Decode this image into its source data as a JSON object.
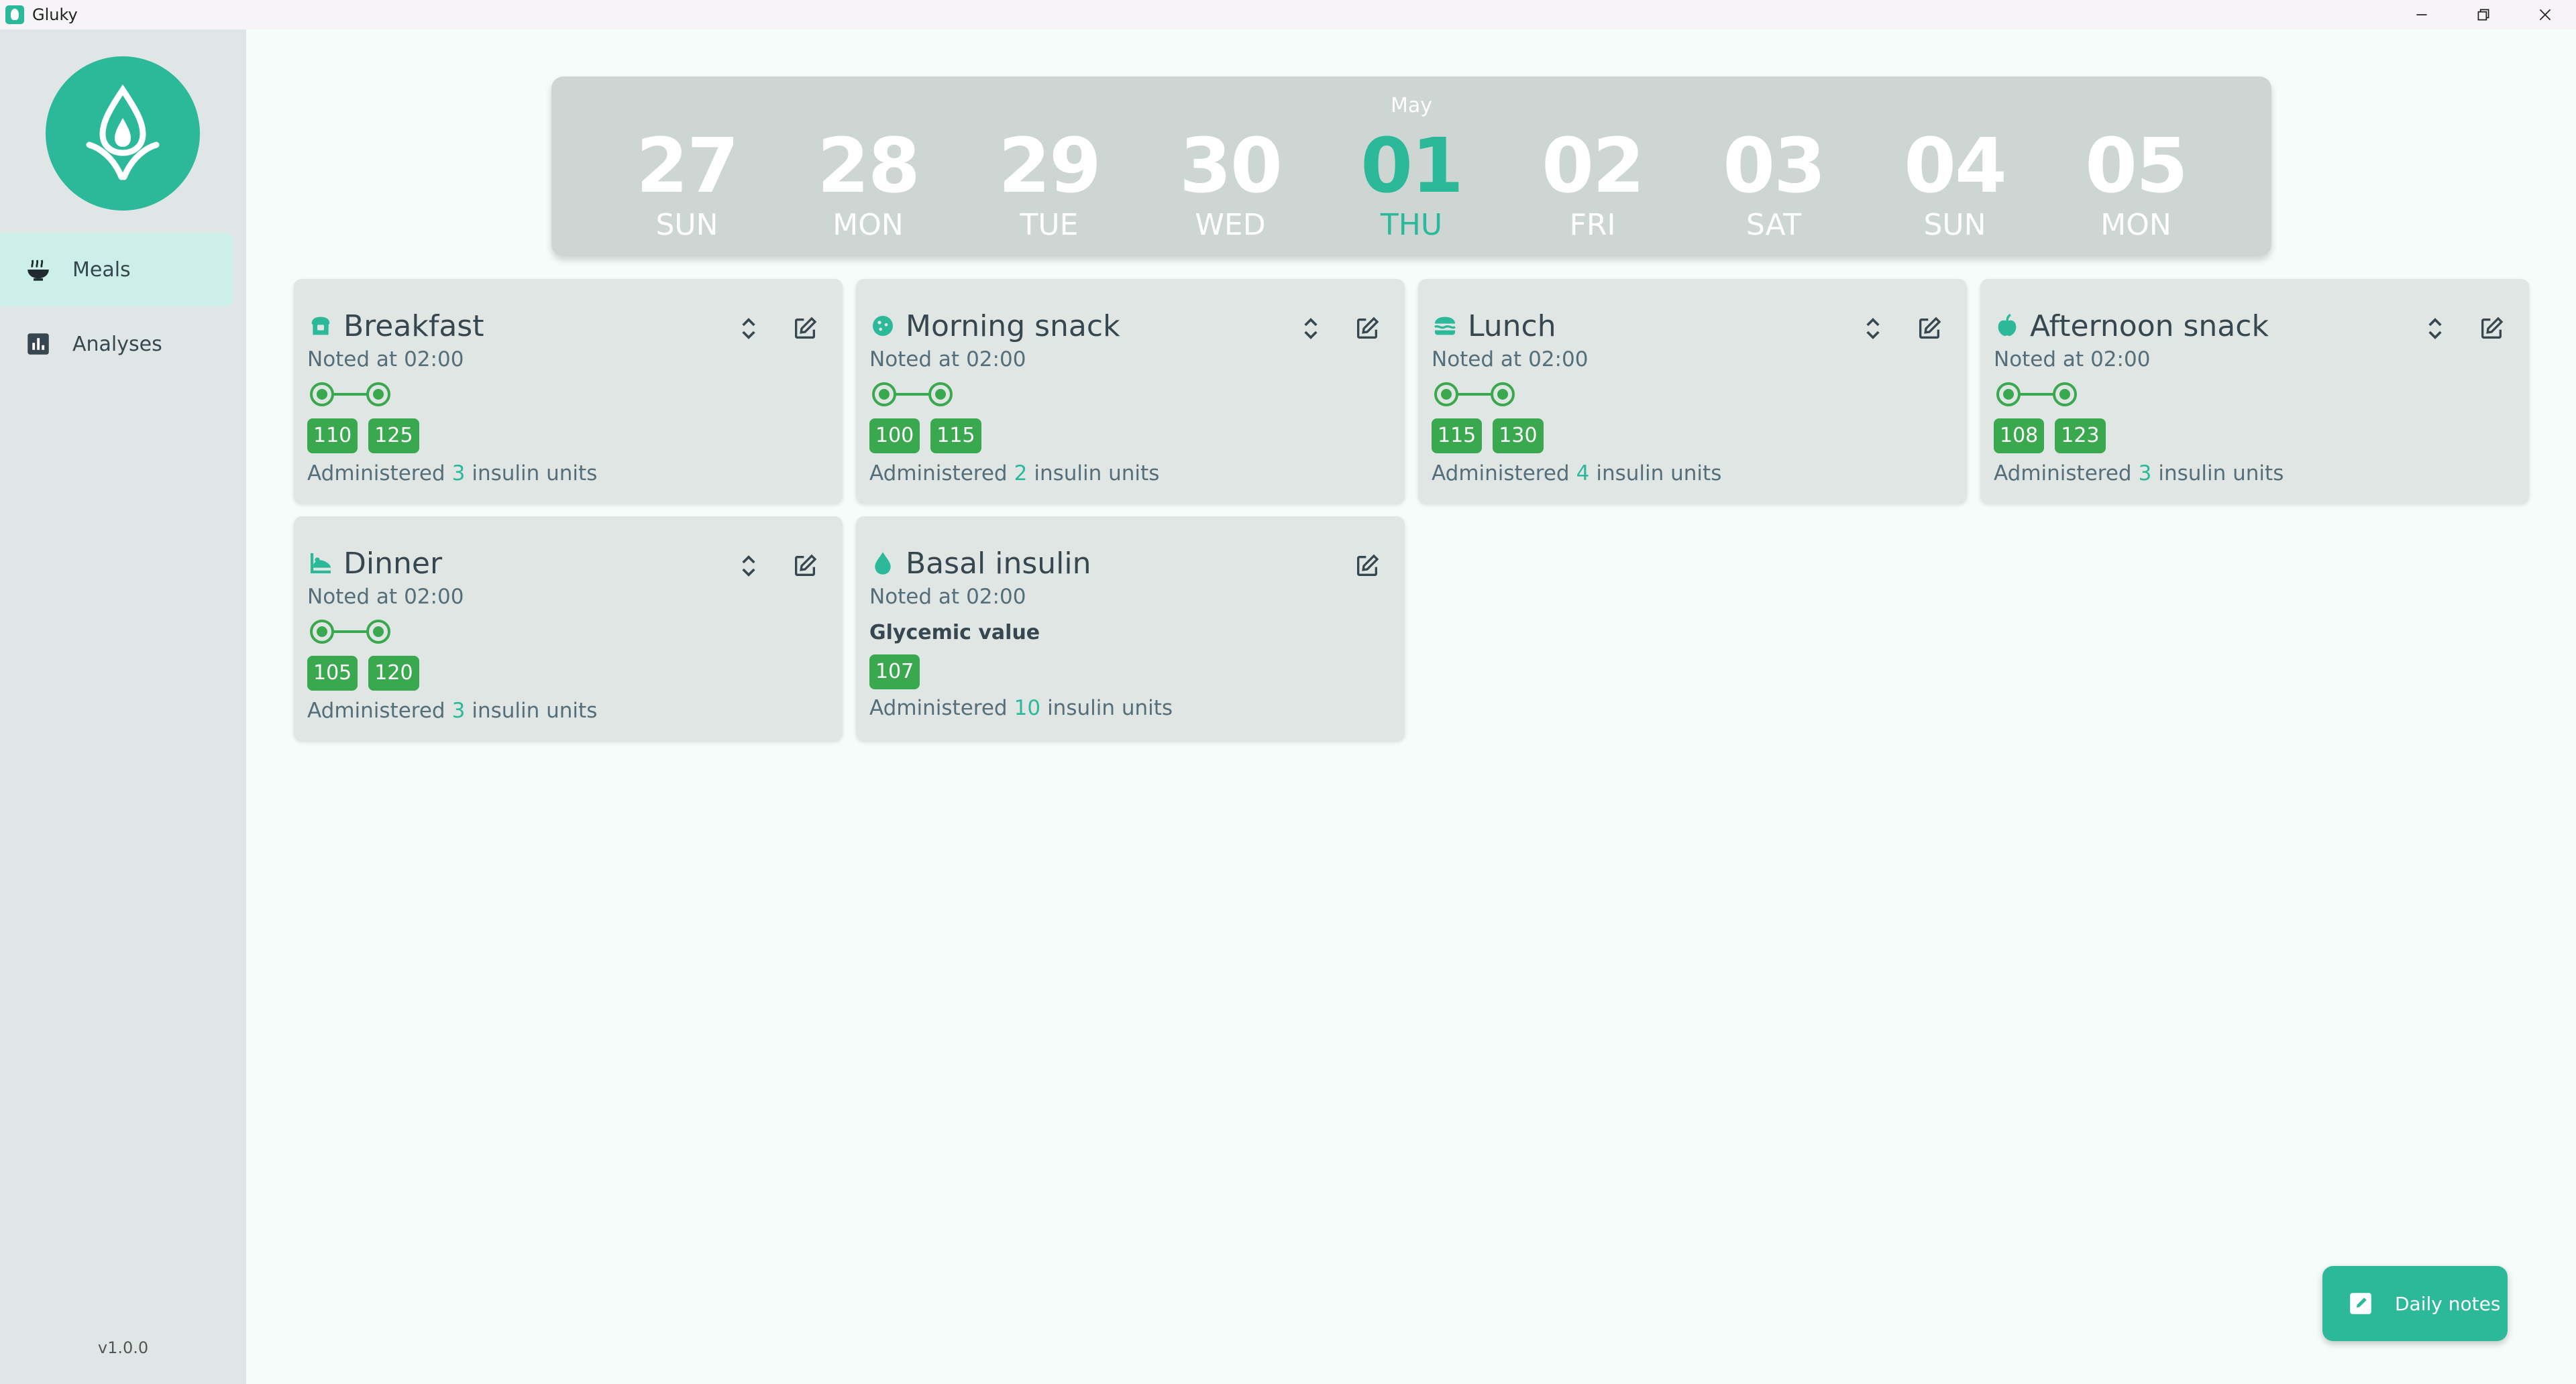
{
  "window": {
    "title": "Gluky"
  },
  "sidebar": {
    "items": [
      {
        "label": "Meals",
        "icon": "meal-bowl-icon",
        "active": true
      },
      {
        "label": "Analyses",
        "icon": "bar-chart-icon",
        "active": false
      }
    ],
    "version": "v1.0.0"
  },
  "calendar": {
    "month": "May",
    "days": [
      {
        "num": "27",
        "weekday": "SUN"
      },
      {
        "num": "28",
        "weekday": "MON"
      },
      {
        "num": "29",
        "weekday": "TUE"
      },
      {
        "num": "30",
        "weekday": "WED"
      },
      {
        "num": "01",
        "weekday": "THU",
        "selected": true
      },
      {
        "num": "02",
        "weekday": "FRI"
      },
      {
        "num": "03",
        "weekday": "SAT"
      },
      {
        "num": "04",
        "weekday": "SUN"
      },
      {
        "num": "05",
        "weekday": "MON"
      }
    ]
  },
  "meals": [
    {
      "title": "Breakfast",
      "icon": "breakfast-toast-icon",
      "noted_prefix": "Noted at",
      "noted_time": "02:00",
      "values": [
        "110",
        "125"
      ],
      "admin_prefix": "Administered",
      "units": "3",
      "admin_suffix": "insulin units"
    },
    {
      "title": "Morning snack",
      "icon": "cookie-icon",
      "noted_prefix": "Noted at",
      "noted_time": "02:00",
      "values": [
        "100",
        "115"
      ],
      "admin_prefix": "Administered",
      "units": "2",
      "admin_suffix": "insulin units"
    },
    {
      "title": "Lunch",
      "icon": "burger-icon",
      "noted_prefix": "Noted at",
      "noted_time": "02:00",
      "values": [
        "115",
        "130"
      ],
      "admin_prefix": "Administered",
      "units": "4",
      "admin_suffix": "insulin units"
    },
    {
      "title": "Afternoon snack",
      "icon": "apple-icon",
      "noted_prefix": "Noted at",
      "noted_time": "02:00",
      "values": [
        "108",
        "123"
      ],
      "admin_prefix": "Administered",
      "units": "3",
      "admin_suffix": "insulin units"
    },
    {
      "title": "Dinner",
      "icon": "dinner-plate-icon",
      "noted_prefix": "Noted at",
      "noted_time": "02:00",
      "values": [
        "105",
        "120"
      ],
      "admin_prefix": "Administered",
      "units": "3",
      "admin_suffix": "insulin units"
    }
  ],
  "basal": {
    "title": "Basal insulin",
    "icon": "drop-icon",
    "noted_prefix": "Noted at",
    "noted_time": "02:00",
    "glycemic_label": "Glycemic value",
    "value": "107",
    "admin_prefix": "Administered",
    "units": "10",
    "admin_suffix": "insulin units"
  },
  "fab": {
    "label": "Daily notes",
    "icon": "notes-edit-icon"
  },
  "colors": {
    "accent": "#2bb99a",
    "badge": "#3aa84e",
    "sidebar": "#e0e6e5",
    "card": "#dfe6e3"
  }
}
